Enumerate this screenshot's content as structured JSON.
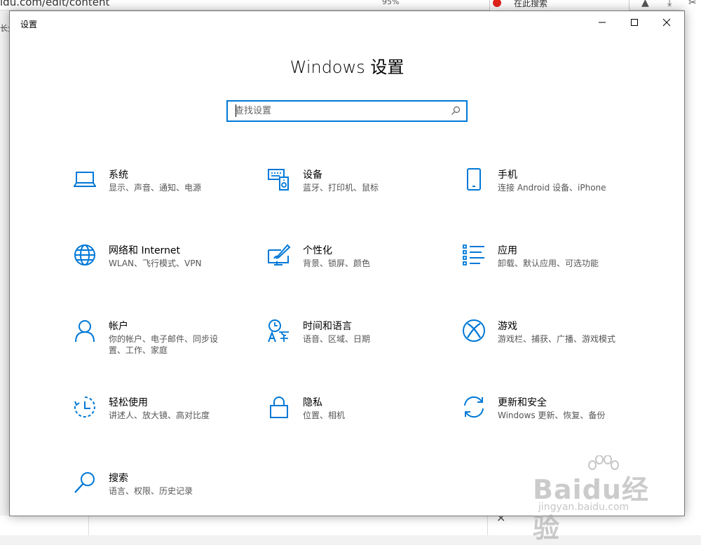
{
  "background": {
    "url_text": "idu.com/edit/content",
    "zoom": "95%",
    "search_text": "在此搜索",
    "left_text": "长分"
  },
  "window": {
    "app_title": "设置",
    "minimize_glyph": "—",
    "maximize_glyph": "☐",
    "close_glyph": "✕"
  },
  "page": {
    "title": "Windows 设置",
    "search_placeholder": "查找设置"
  },
  "tiles": [
    {
      "name": "系统",
      "desc": "显示、声音、通知、电源",
      "icon": "laptop-icon"
    },
    {
      "name": "设备",
      "desc": "蓝牙、打印机、鼠标",
      "icon": "devices-icon"
    },
    {
      "name": "手机",
      "desc": "连接 Android 设备、iPhone",
      "icon": "phone-icon"
    },
    {
      "name": "网络和 Internet",
      "desc": "WLAN、飞行模式、VPN",
      "icon": "globe-icon"
    },
    {
      "name": "个性化",
      "desc": "背景、锁屏、颜色",
      "icon": "paint-icon"
    },
    {
      "name": "应用",
      "desc": "卸载、默认应用、可选功能",
      "icon": "apps-list-icon"
    },
    {
      "name": "帐户",
      "desc": "你的帐户、电子邮件、同步设置、工作、家庭",
      "icon": "person-icon"
    },
    {
      "name": "时间和语言",
      "desc": "语音、区域、日期",
      "icon": "time-language-icon"
    },
    {
      "name": "游戏",
      "desc": "游戏栏、捕获、广播、游戏模式",
      "icon": "xbox-icon"
    },
    {
      "name": "轻松使用",
      "desc": "讲述人、放大镜、高对比度",
      "icon": "ease-of-access-icon"
    },
    {
      "name": "隐私",
      "desc": "位置、相机",
      "icon": "lock-icon"
    },
    {
      "name": "更新和安全",
      "desc": "Windows 更新、恢复、备份",
      "icon": "update-icon"
    },
    {
      "name": "搜索",
      "desc": "语言、权限、历史记录",
      "icon": "search-icon"
    }
  ],
  "watermark": {
    "main": "Baidu经验",
    "sub": "jingyan.baidu.com"
  },
  "accent_color": "#0078d7"
}
